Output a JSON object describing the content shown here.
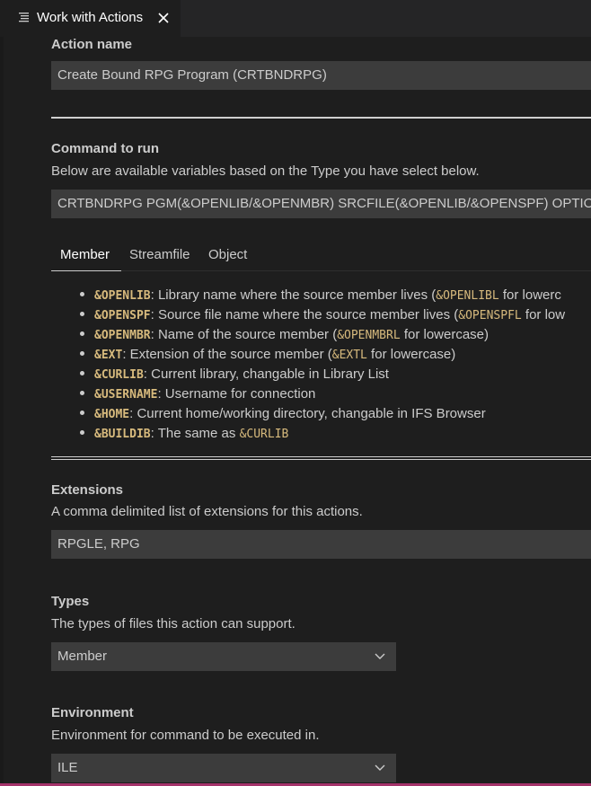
{
  "tab": {
    "icon": "preview-icon",
    "title": "Work with Actions",
    "close_icon": "close-icon"
  },
  "action_name": {
    "label": "Action name",
    "value": "Create Bound RPG Program (CRTBNDRPG)"
  },
  "command": {
    "label": "Command to run",
    "description": "Below are available variables based on the Type you have select below.",
    "value": "CRTBNDRPG PGM(&OPENLIB/&OPENMBR) SRCFILE(&OPENLIB/&OPENSPF) OPTION(*"
  },
  "variable_tabs": [
    {
      "label": "Member",
      "active": true
    },
    {
      "label": "Streamfile",
      "active": false
    },
    {
      "label": "Object",
      "active": false
    }
  ],
  "variables": [
    {
      "name": "&OPENLIB",
      "text": ": Library name where the source member lives (",
      "alt": "&OPENLIBL",
      "tail": " for lowerc"
    },
    {
      "name": "&OPENSPF",
      "text": ": Source file name where the source member lives (",
      "alt": "&OPENSPFL",
      "tail": " for low"
    },
    {
      "name": "&OPENMBR",
      "text": ": Name of the source member (",
      "alt": "&OPENMBRL",
      "tail": " for lowercase)"
    },
    {
      "name": "&EXT",
      "text": ": Extension of the source member (",
      "alt": "&EXTL",
      "tail": " for lowercase)"
    },
    {
      "name": "&CURLIB",
      "text": ": Current library, changable in Library List",
      "alt": "",
      "tail": ""
    },
    {
      "name": "&USERNAME",
      "text": ": Username for connection",
      "alt": "",
      "tail": ""
    },
    {
      "name": "&HOME",
      "text": ": Current home/working directory, changable in IFS Browser",
      "alt": "",
      "tail": ""
    },
    {
      "name": "&BUILDIB",
      "text": ": The same as ",
      "alt": "&CURLIB",
      "tail": ""
    }
  ],
  "extensions": {
    "label": "Extensions",
    "description": "A comma delimited list of extensions for this actions.",
    "value": "RPGLE, RPG"
  },
  "types": {
    "label": "Types",
    "description": "The types of files this action can support.",
    "selected": "Member",
    "chevron_icon": "chevron-down-icon"
  },
  "environment": {
    "label": "Environment",
    "description": "Environment for command to be executed in.",
    "selected": "ILE",
    "chevron_icon": "chevron-down-icon"
  },
  "colors": {
    "background": "#1e1e1e",
    "input_background": "#3c3c3c",
    "variable_code": "#d7ba7d",
    "status_accent": "#a5336b"
  }
}
